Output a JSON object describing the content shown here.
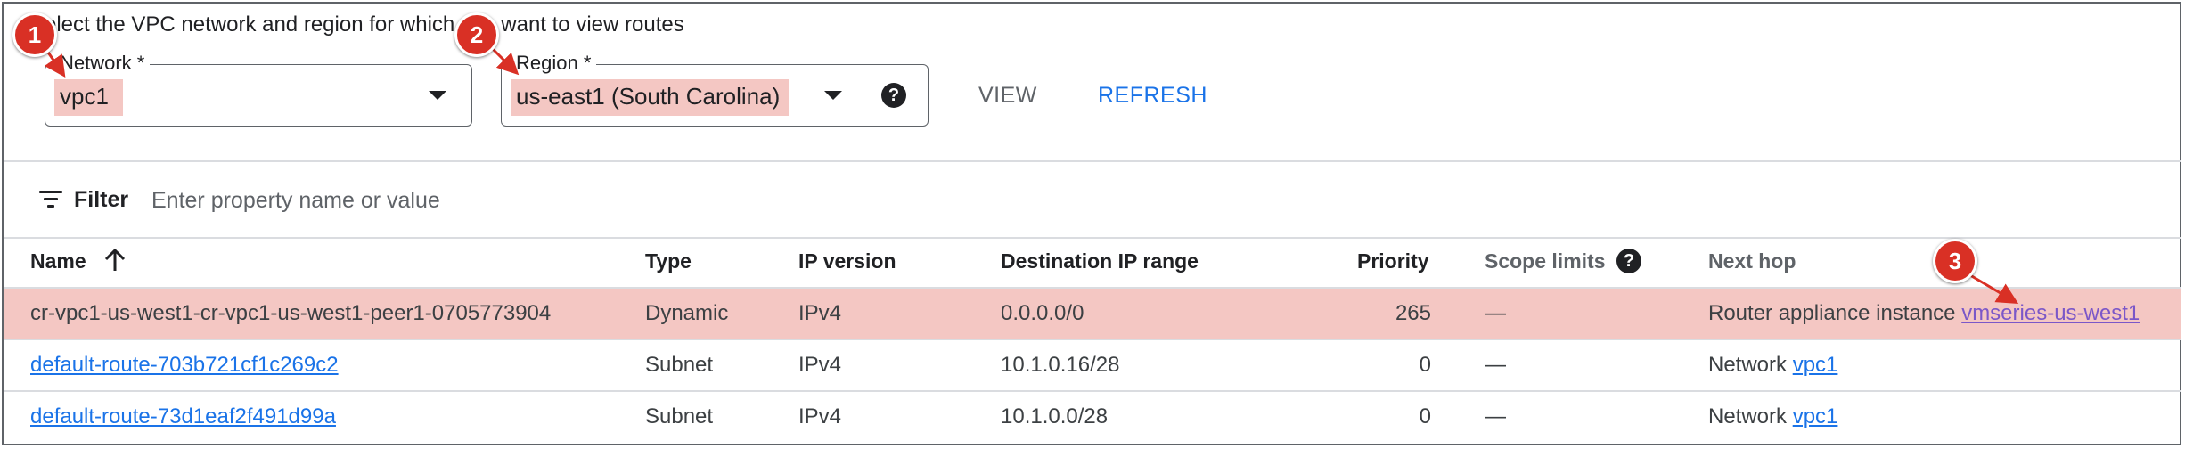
{
  "instruction": "elect the VPC network and region for which you want to view routes",
  "network_field": {
    "label": "Network *",
    "value": "vpc1"
  },
  "region_field": {
    "label": "Region *",
    "value": "us-east1 (South Carolina)"
  },
  "help_icon_glyph": "?",
  "actions": {
    "view": "VIEW",
    "refresh": "REFRESH"
  },
  "filter": {
    "label": "Filter",
    "placeholder": "Enter property name or value"
  },
  "table": {
    "headers": {
      "name": "Name",
      "type": "Type",
      "ip_version": "IP version",
      "dest_range": "Destination IP range",
      "priority": "Priority",
      "scope_limits": "Scope limits",
      "next_hop": "Next hop"
    },
    "rows": [
      {
        "name": "cr-vpc1-us-west1-cr-vpc1-us-west1-peer1-0705773904",
        "type": "Dynamic",
        "ip_version": "IPv4",
        "dest_range": "0.0.0.0/0",
        "priority": "265",
        "scope": "—",
        "next_hop_prefix": "Router appliance instance",
        "next_hop_link": "vmseries-us-west1"
      },
      {
        "name": "default-route-703b721cf1c269c2",
        "type": "Subnet",
        "ip_version": "IPv4",
        "dest_range": "10.1.0.16/28",
        "priority": "0",
        "scope": "—",
        "next_hop_prefix": "Network",
        "next_hop_link": "vpc1"
      },
      {
        "name": "default-route-73d1eaf2f491d99a",
        "type": "Subnet",
        "ip_version": "IPv4",
        "dest_range": "10.1.0.0/28",
        "priority": "0",
        "scope": "—",
        "next_hop_prefix": "Network",
        "next_hop_link": "vpc1"
      }
    ]
  },
  "callouts": [
    "1",
    "2",
    "3"
  ],
  "colors": {
    "highlight": "#f4c7c3",
    "callout": "#d93025",
    "link": "#1a73e8"
  }
}
